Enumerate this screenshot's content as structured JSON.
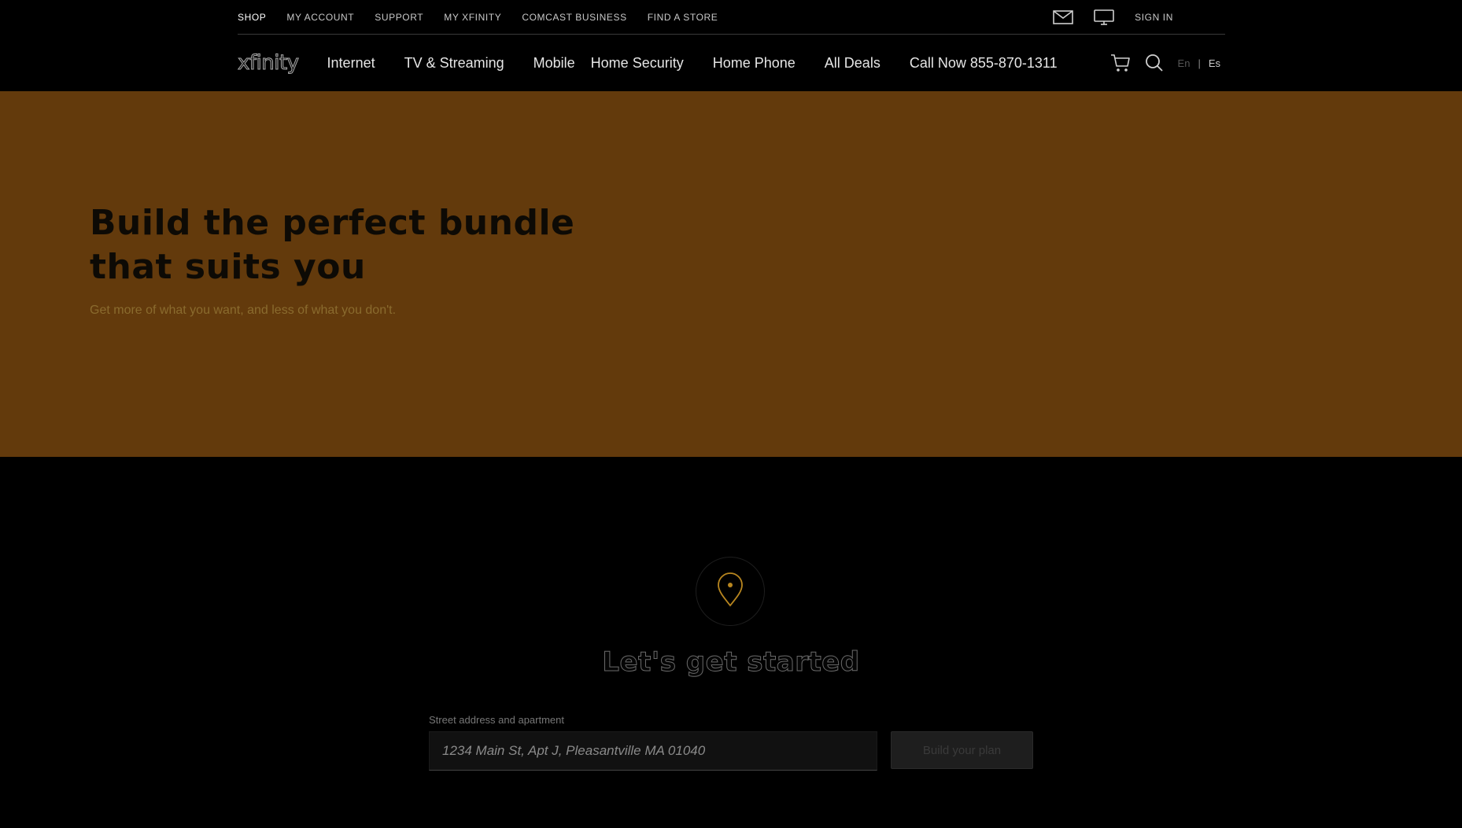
{
  "utility_nav": {
    "items": [
      {
        "label": "SHOP",
        "active": true
      },
      {
        "label": "MY ACCOUNT"
      },
      {
        "label": "SUPPORT"
      },
      {
        "label": "MY XFINITY"
      },
      {
        "label": "COMCAST BUSINESS"
      },
      {
        "label": "FIND A STORE"
      }
    ],
    "mail_icon": "mail-icon",
    "tv_icon": "monitor-icon",
    "sign_in": "SIGN IN"
  },
  "main_nav": {
    "logo": "xfinity",
    "items": [
      "Internet",
      "TV & Streaming",
      "Mobile",
      "Home Security",
      "Home Phone",
      "All Deals",
      "Call Now 855-870-1311"
    ],
    "cart_icon": "cart-icon",
    "search_icon": "search-icon",
    "lang_en": "En",
    "lang_sep": "|",
    "lang_es": "Es"
  },
  "hero": {
    "title": "Build the perfect bundle that suits you",
    "subtitle": "Get more of what you want, and less of what you don't.",
    "background": "#633a0c"
  },
  "address": {
    "icon": "location-pin-icon",
    "title": "Let's get started",
    "label": "Street address and apartment",
    "placeholder": "1234 Main St, Apt J, Pleasantville MA 01040",
    "button": "Build your plan"
  }
}
